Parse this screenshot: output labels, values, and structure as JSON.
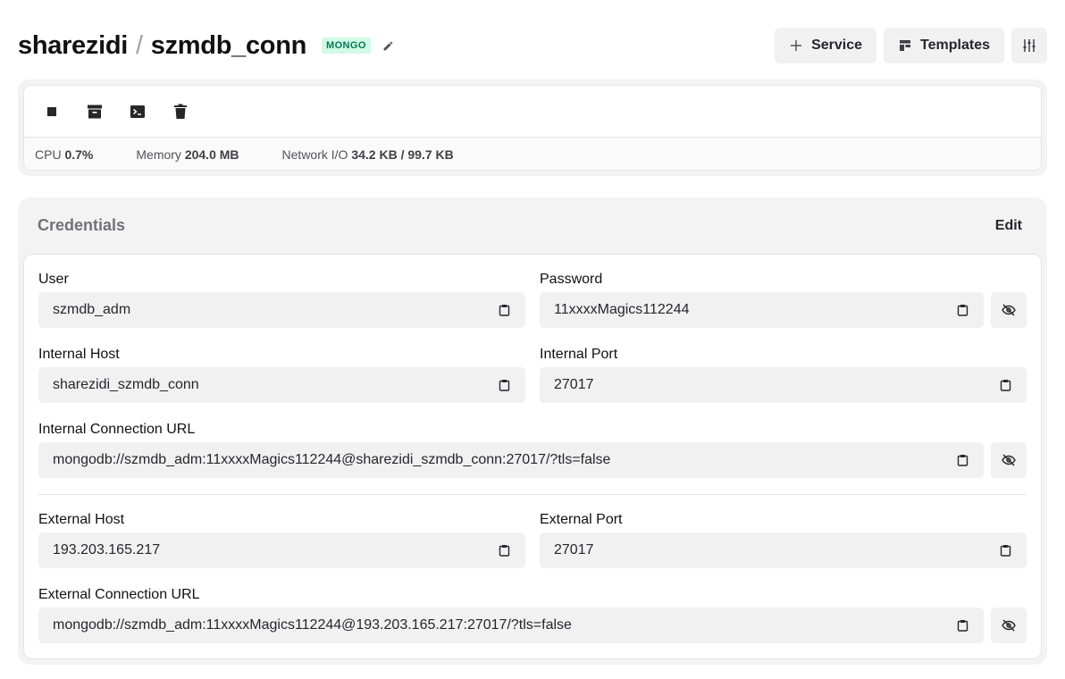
{
  "header": {
    "project": "sharezidi",
    "separator": "/",
    "service": "szmdb_conn",
    "badge": "MONGO",
    "service_button": "Service",
    "templates_button": "Templates"
  },
  "metrics": {
    "cpu_label": "CPU",
    "cpu_value": "0.7%",
    "memory_label": "Memory",
    "memory_value": "204.0 MB",
    "network_label": "Network I/O",
    "network_value": "34.2 KB / 99.7 KB"
  },
  "credentials": {
    "title": "Credentials",
    "edit_label": "Edit",
    "user": {
      "label": "User",
      "value": "szmdb_adm"
    },
    "password": {
      "label": "Password",
      "value": "11xxxxMagics112244"
    },
    "internal_host": {
      "label": "Internal Host",
      "value": "sharezidi_szmdb_conn"
    },
    "internal_port": {
      "label": "Internal Port",
      "value": "27017"
    },
    "internal_url": {
      "label": "Internal Connection URL",
      "value": "mongodb://szmdb_adm:11xxxxMagics112244@sharezidi_szmdb_conn:27017/?tls=false"
    },
    "external_host": {
      "label": "External Host",
      "value": "193.203.165.217"
    },
    "external_port": {
      "label": "External Port",
      "value": "27017"
    },
    "external_url": {
      "label": "External Connection URL",
      "value": "mongodb://szmdb_adm:11xxxxMagics112244@193.203.165.217:27017/?tls=false"
    }
  }
}
